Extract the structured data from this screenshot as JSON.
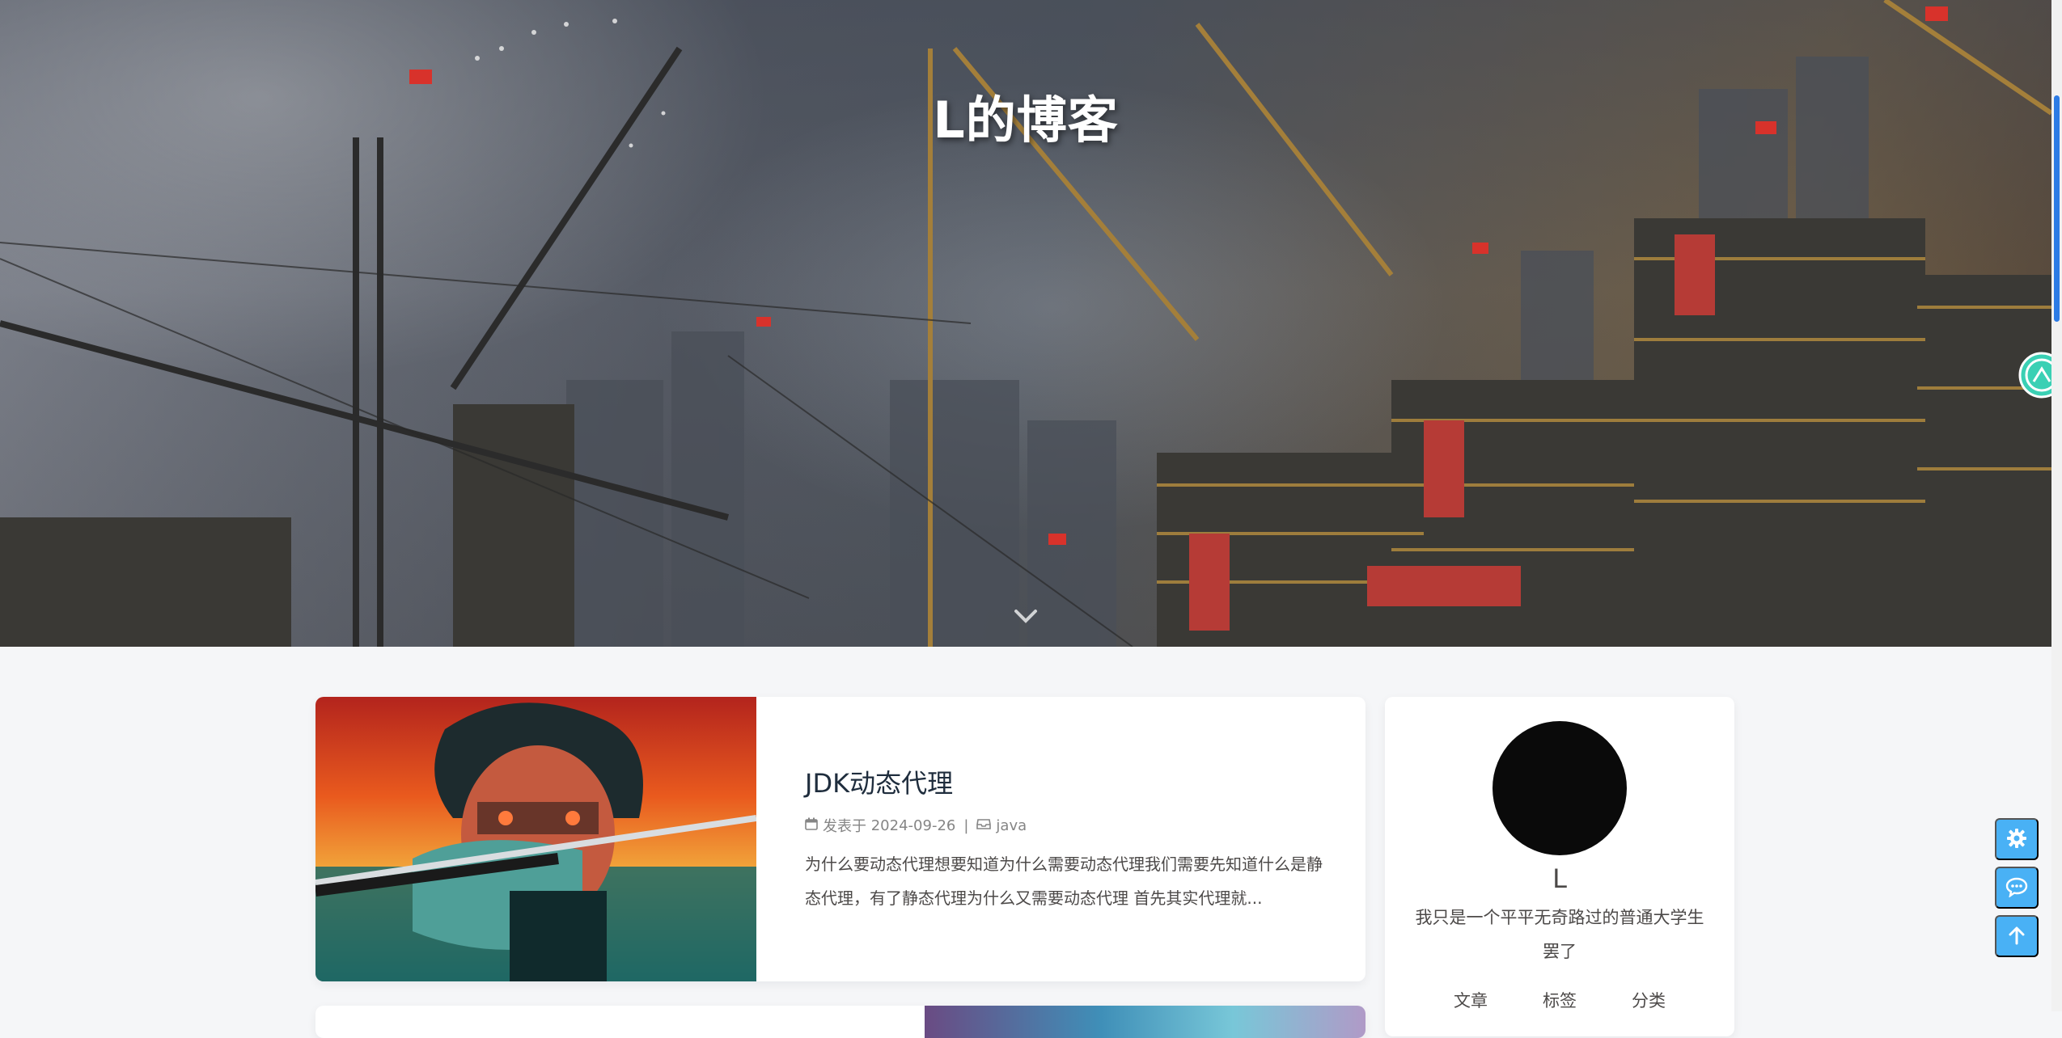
{
  "site": {
    "title": "L的博客"
  },
  "post": {
    "title": "JDK动态代理",
    "meta_prefix": "发表于",
    "date": "2024-09-26",
    "separator": "|",
    "category": "java",
    "excerpt": "为什么要动态代理想要知道为什么需要动态代理我们需要先知道什么是静态代理，有了静态代理为什么又需要动态代理 首先其实代理就..."
  },
  "author": {
    "name": "L",
    "description": "我只是一个平平无奇路过的普通大学生罢了",
    "stats": [
      {
        "label": "文章"
      },
      {
        "label": "标签"
      },
      {
        "label": "分类"
      }
    ]
  },
  "icons": {
    "scroll": "chevron-down-icon",
    "calendar": "calendar-icon",
    "category": "inbox-icon",
    "settings": "gear-icon",
    "comments": "comment-icon",
    "top": "arrow-up-icon",
    "mascot": "mascot-icon"
  },
  "colors": {
    "accent": "#49b1f5",
    "scrollbar": "#2c7be5",
    "title_text": "#1f2d3d",
    "meta_text": "#858585"
  }
}
